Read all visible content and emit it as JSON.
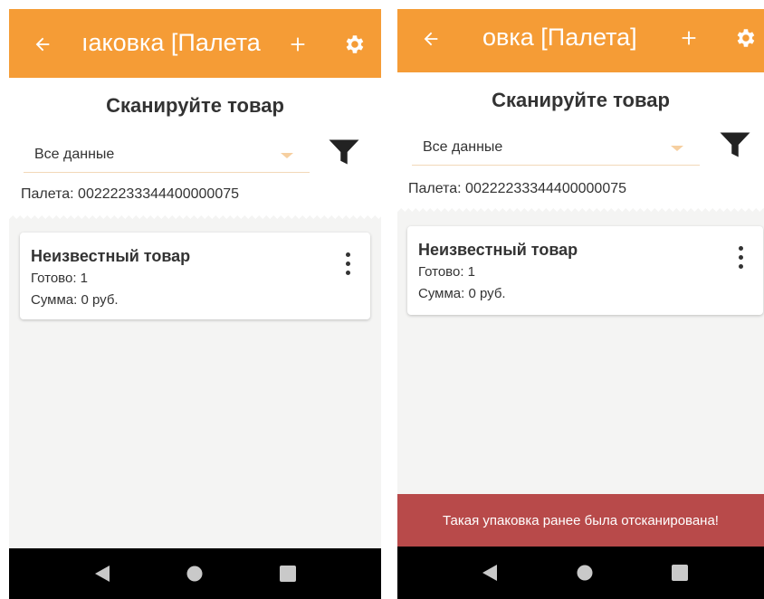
{
  "colors": {
    "appbar": "#f59c36",
    "snackbar": "#b84a4a",
    "navbar": "#000000",
    "background": "#f4f4f3"
  },
  "left": {
    "appbar": {
      "title": "ıаковка [Палета",
      "icons": [
        "arrow-left-icon",
        "plus-icon",
        "gear-icon"
      ]
    },
    "scan_prompt": "Сканируйте товар",
    "filter_select": {
      "value": "Все данные"
    },
    "pallet_label": "Палета: 00222233344400000075",
    "items": [
      {
        "name": "Неизвестный товар",
        "ready": "Готово: 1",
        "sum": "Сумма: 0 руб."
      }
    ]
  },
  "right": {
    "appbar": {
      "title": "овка [Палета]",
      "icons": [
        "arrow-left-icon",
        "plus-icon",
        "gear-icon"
      ]
    },
    "scan_prompt": "Сканируйте товар",
    "filter_select": {
      "value": "Все данные"
    },
    "pallet_label": "Палета: 00222233344400000075",
    "items": [
      {
        "name": "Неизвестный товар",
        "ready": "Готово: 1",
        "sum": "Сумма: 0 руб."
      }
    ],
    "snackbar": "Такая упаковка ранее была отсканирована!"
  }
}
